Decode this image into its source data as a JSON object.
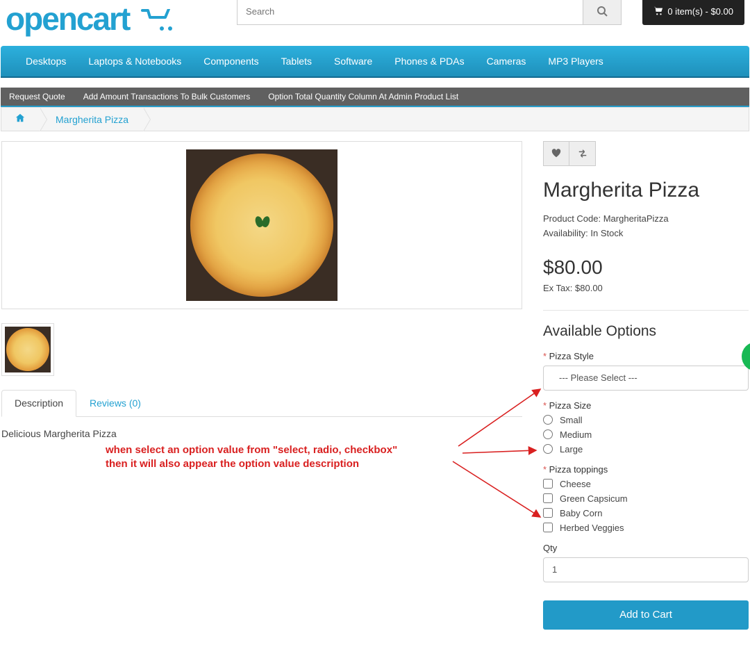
{
  "header": {
    "logo": "opencart",
    "search_placeholder": "Search",
    "cart_text": "0 item(s) - $0.00"
  },
  "nav": [
    "Desktops",
    "Laptops & Notebooks",
    "Components",
    "Tablets",
    "Software",
    "Phones & PDAs",
    "Cameras",
    "MP3 Players"
  ],
  "subbar": [
    "Request Quote",
    "Add Amount Transactions To Bulk Customers",
    "Option Total Quantity Column At Admin Product List"
  ],
  "breadcrumb": {
    "product": "Margherita Pizza"
  },
  "tabs": {
    "desc": "Description",
    "reviews": "Reviews (0)"
  },
  "desc_body": "Delicious Margherita Pizza",
  "annotation": {
    "l1": "when select an option value from \"select, radio, checkbox\"",
    "l2": "then it will also appear the option value description"
  },
  "product": {
    "title": "Margherita Pizza",
    "code_label": "Product Code: ",
    "code": "MargheritaPizza",
    "avail_label": "Availability: ",
    "avail": "In Stock",
    "price": "$80.00",
    "extax_label": "Ex Tax: ",
    "extax": "$80.00"
  },
  "options": {
    "heading": "Available Options",
    "style": {
      "label": "Pizza Style",
      "placeholder": "--- Please Select ---"
    },
    "size": {
      "label": "Pizza Size",
      "items": [
        "Small",
        "Medium",
        "Large"
      ]
    },
    "toppings": {
      "label": "Pizza toppings",
      "items": [
        "Cheese",
        "Green Capsicum",
        "Baby Corn",
        "Herbed Veggies"
      ]
    },
    "qty_label": "Qty",
    "qty_value": "1",
    "add": "Add to Cart"
  }
}
